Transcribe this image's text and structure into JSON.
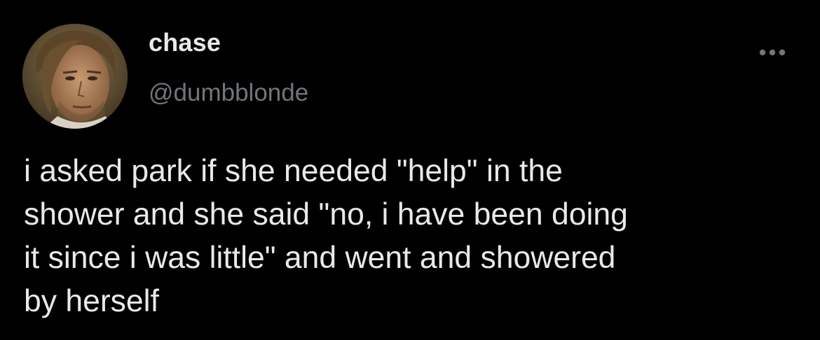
{
  "tweet": {
    "author": {
      "display_name": "chase",
      "handle": "@dumbblonde",
      "avatar_icon": "profile-photo"
    },
    "more_icon": "ellipsis-icon",
    "text": "i asked park if she needed \"help\" in the\nshower and she said \"no, i have been doing\nit since i was little\" and went and showered\nby herself"
  },
  "colors": {
    "background": "#000000",
    "primary_text": "#e7e9ea",
    "secondary_text": "#71767b"
  }
}
